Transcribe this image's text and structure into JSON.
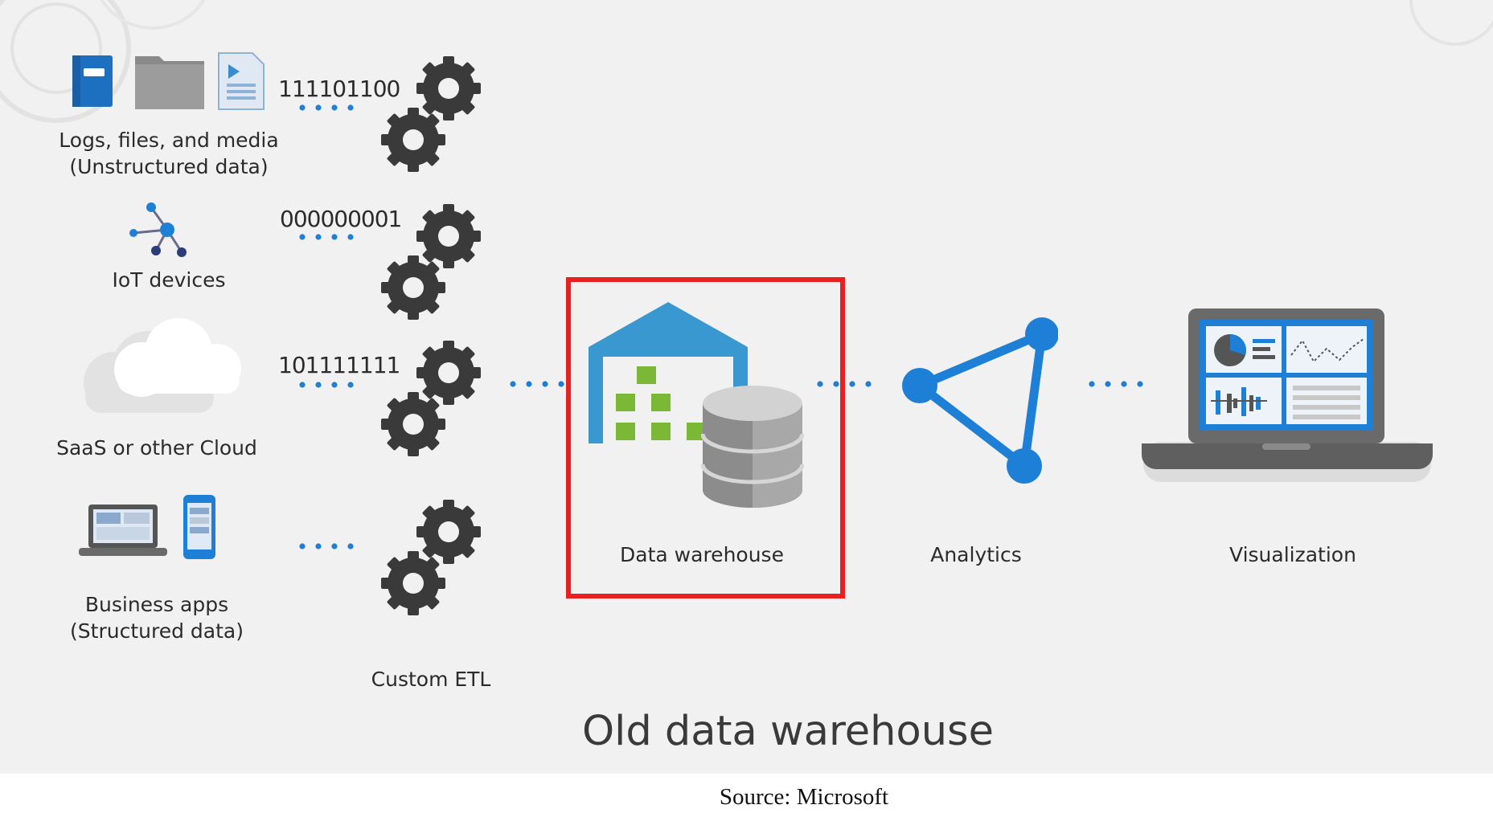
{
  "diagram": {
    "title": "Old data warehouse",
    "source": "Source: Microsoft",
    "sources": [
      {
        "label_line1": "Logs, files, and media",
        "label_line2": "(Unstructured data)",
        "stream": "111101100"
      },
      {
        "label_line1": "IoT devices",
        "stream": "000000001"
      },
      {
        "label_line1": "SaaS or other Cloud",
        "stream": "101111111"
      },
      {
        "label_line1": "Business apps",
        "label_line2": "(Structured data)"
      }
    ],
    "etl_label": "Custom ETL",
    "pipeline": {
      "warehouse": "Data warehouse",
      "analytics": "Analytics",
      "visualization": "Visualization"
    }
  },
  "colors": {
    "background": "#f1f1f1",
    "accent_blue": "#1e7fd6",
    "highlight_red": "#e82020",
    "gear_gray": "#3a3a3a"
  }
}
